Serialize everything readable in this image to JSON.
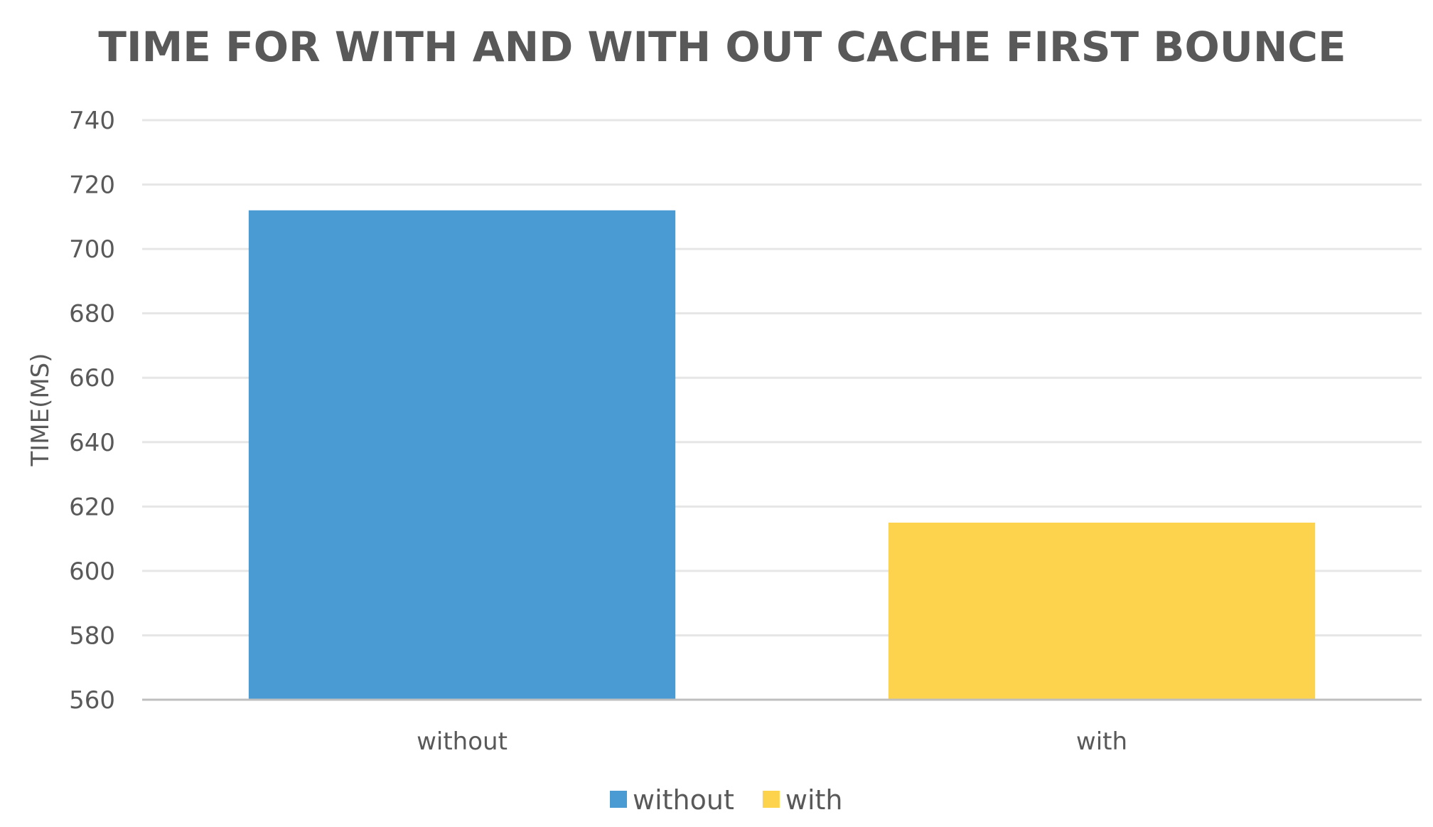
{
  "chart_data": {
    "type": "bar",
    "title": "TIME FOR WITH AND WITH OUT CACHE FIRST BOUNCE",
    "xlabel": "",
    "ylabel": "TIME(MS)",
    "categories": [
      "without",
      "with"
    ],
    "series": [
      {
        "name": "without",
        "values": [
          712
        ],
        "color": "#4a9bd4"
      },
      {
        "name": "with",
        "values": [
          615
        ],
        "color": "#fdd34e"
      }
    ],
    "ylim": [
      560,
      740
    ],
    "yticks": [
      560,
      580,
      600,
      620,
      640,
      660,
      680,
      700,
      720,
      740
    ],
    "grid": true,
    "legend": "bottom-center"
  }
}
